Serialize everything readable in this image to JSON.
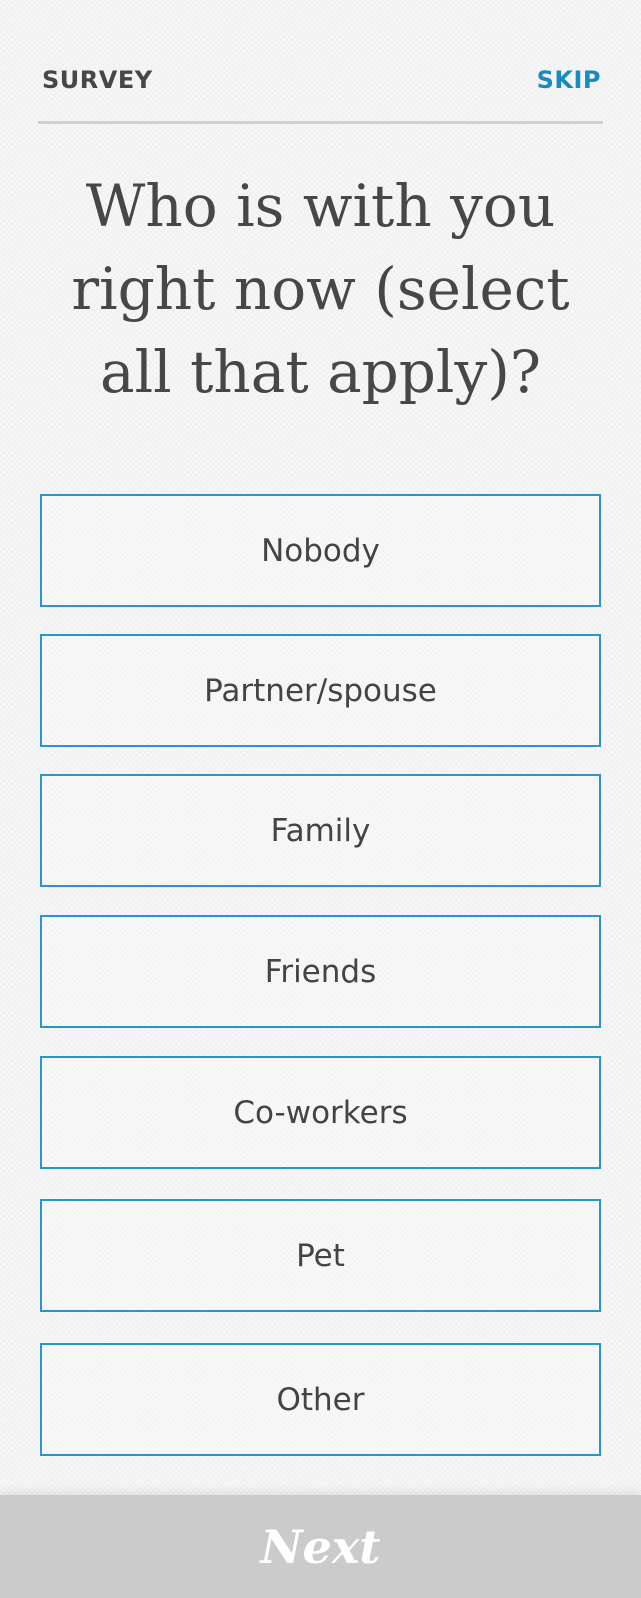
{
  "header": {
    "title": "SURVEY",
    "skip_label": "SKIP"
  },
  "question": "Who is with you right now (select all that apply)?",
  "options": [
    {
      "label": "Nobody"
    },
    {
      "label": "Partner/spouse"
    },
    {
      "label": "Family"
    },
    {
      "label": "Friends"
    },
    {
      "label": "Co-workers"
    },
    {
      "label": "Pet"
    },
    {
      "label": "Other"
    }
  ],
  "footer": {
    "next_label": "Next"
  },
  "colors": {
    "accent": "#1a8bc0",
    "option_border": "#2a95c8",
    "text": "#474747",
    "next_bar": "#cbcbcb"
  }
}
